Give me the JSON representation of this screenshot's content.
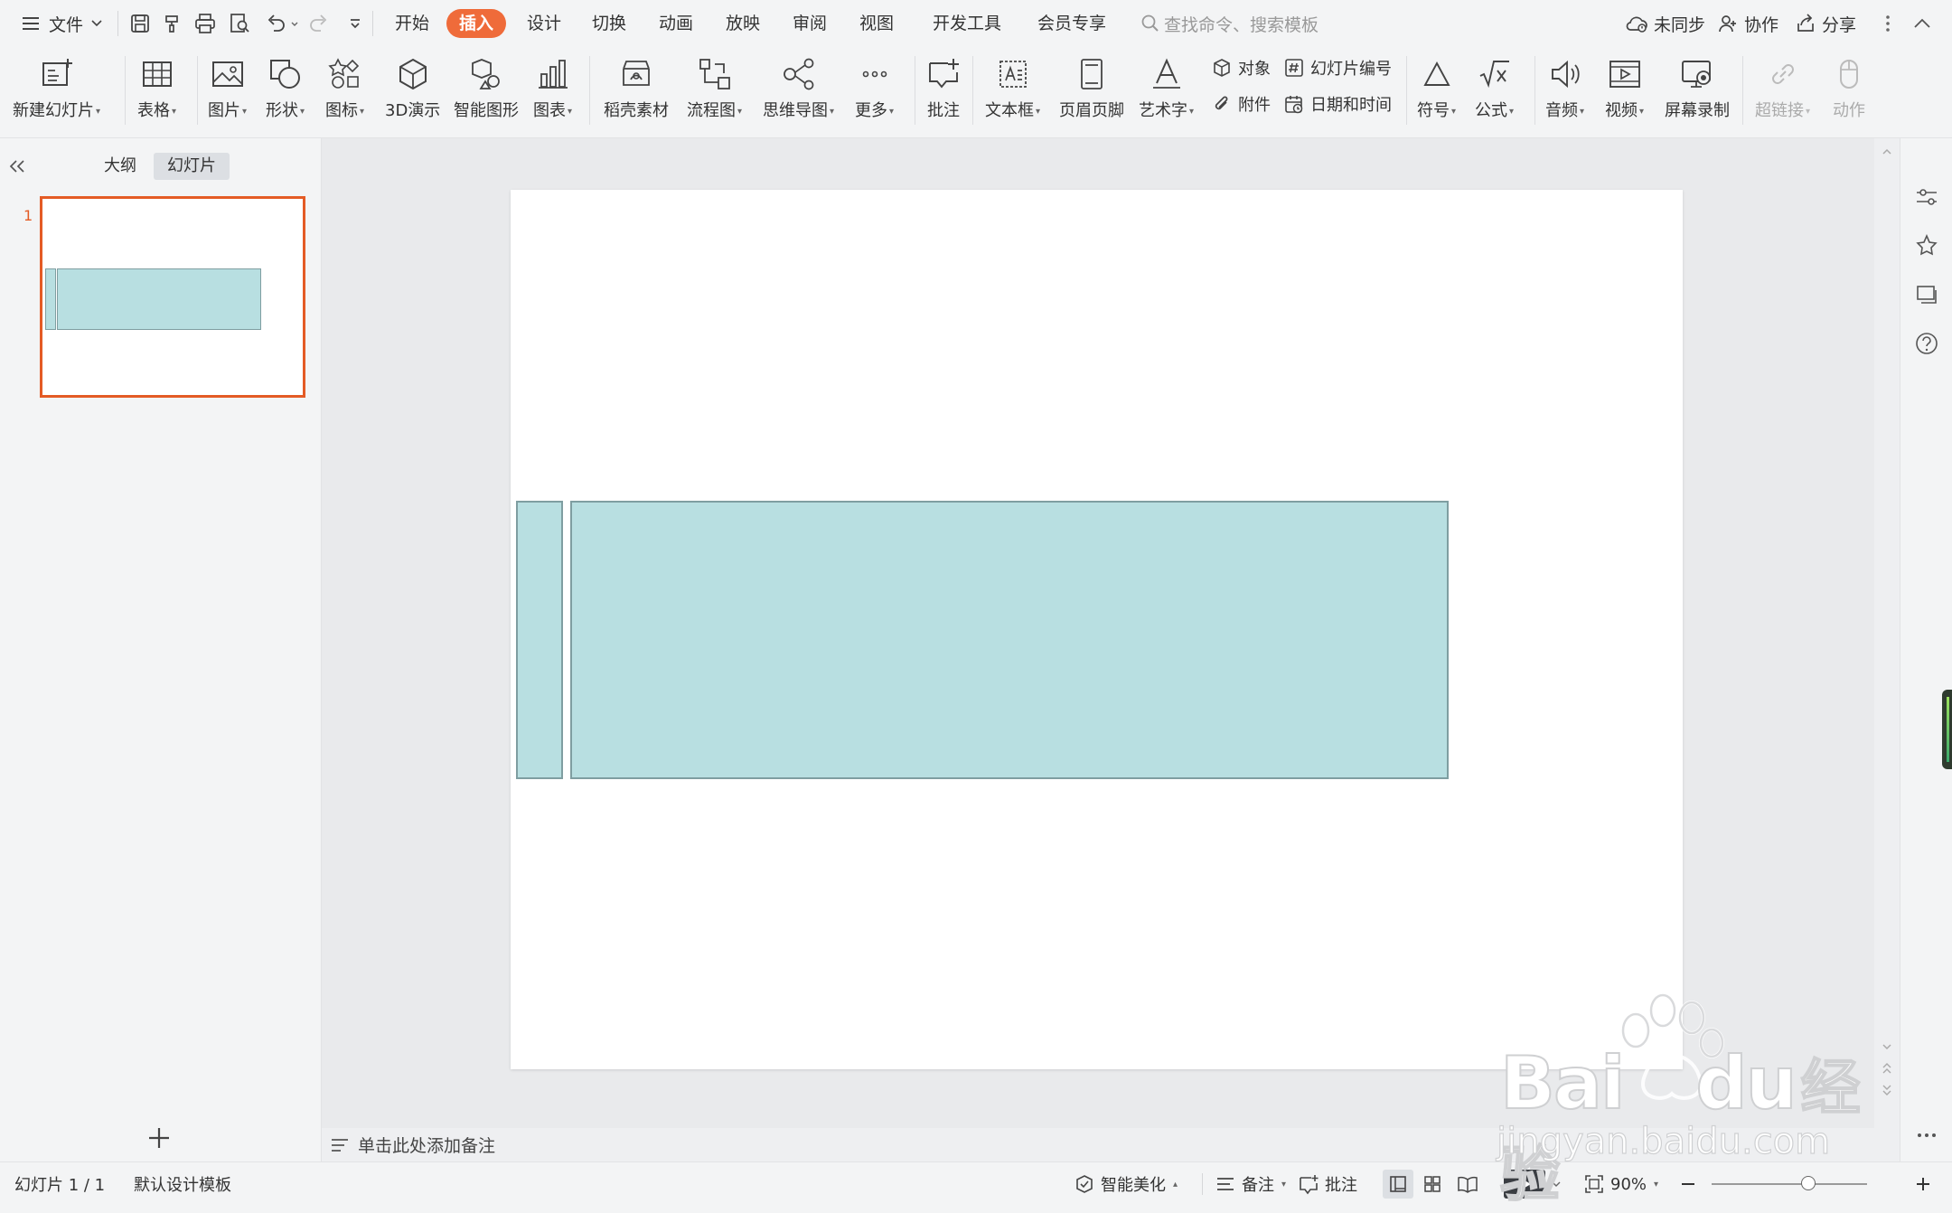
{
  "menubar": {
    "file_label": "文件",
    "tabs": [
      "开始",
      "插入",
      "设计",
      "切换",
      "动画",
      "放映",
      "审阅",
      "视图",
      "开发工具",
      "会员专享"
    ],
    "active_tab": "插入",
    "search_placeholder": "查找命令、搜索模板",
    "sync_label": "未同步",
    "collab_label": "协作",
    "share_label": "分享"
  },
  "ribbon": {
    "new_slide": "新建幻灯片",
    "table": "表格",
    "picture": "图片",
    "shape": "形状",
    "icon": "图标",
    "demo3d": "3D演示",
    "smartart": "智能图形",
    "chart": "图表",
    "material": "稻壳素材",
    "flowchart": "流程图",
    "mindmap": "思维导图",
    "more": "更多",
    "comment": "批注",
    "textbox": "文本框",
    "header_footer": "页眉页脚",
    "wordart": "艺术字",
    "object": "对象",
    "attachment": "附件",
    "slide_number": "幻灯片编号",
    "datetime": "日期和时间",
    "symbol": "符号",
    "formula": "公式",
    "audio": "音频",
    "video": "视频",
    "screen_record": "屏幕录制",
    "hyperlink": "超链接",
    "action": "动作"
  },
  "leftpanel": {
    "tab_outline": "大纲",
    "tab_slides": "幻灯片",
    "slide_index": "1"
  },
  "notes": {
    "placeholder": "单击此处添加备注"
  },
  "statusbar": {
    "slide_counter": "幻灯片 1 / 1",
    "template": "默认设计模板",
    "beautify": "智能美化",
    "notes": "备注",
    "comments": "批注",
    "zoom": "90%",
    "zoom_fraction": 0.62
  },
  "watermark": {
    "brand": "Bai",
    "brand2": "du",
    "brand_cn": "经验",
    "url": "jingyan.baidu.com"
  },
  "colors": {
    "accent": "#ef6b3a",
    "selection_border": "#e45b25",
    "shape_fill": "#b8dfe1",
    "shape_border": "#7f9ea1"
  }
}
